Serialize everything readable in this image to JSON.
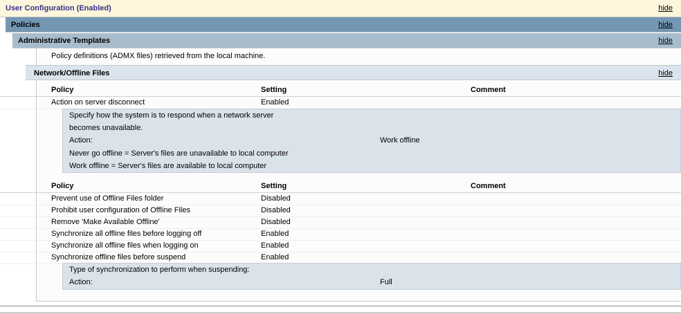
{
  "sections": {
    "user_config": {
      "title": "User Configuration (Enabled)",
      "hide": "hide"
    },
    "policies": {
      "title": "Policies",
      "hide": "hide"
    },
    "admin_templates": {
      "title": "Administrative Templates",
      "hide": "hide",
      "note": "Policy definitions (ADMX files) retrieved from the local machine."
    },
    "network_offline": {
      "title": "Network/Offline Files",
      "hide": "hide"
    }
  },
  "columns": {
    "policy": "Policy",
    "setting": "Setting",
    "comment": "Comment"
  },
  "table1": {
    "rows": [
      {
        "policy": "Action on server disconnect",
        "setting": "Enabled"
      }
    ],
    "detail": {
      "line1": "Specify how the system is to respond when a network server",
      "line2": "becomes unavailable.",
      "action_label": "Action:",
      "action_value": "Work offline",
      "line3": "Never go offline = Server's files are unavailable to local computer",
      "line4": "Work offline = Server's files are available to local computer"
    }
  },
  "table2": {
    "rows": [
      {
        "policy": "Prevent use of Offline Files folder",
        "setting": "Disabled"
      },
      {
        "policy": "Prohibit user configuration of Offline Files",
        "setting": "Disabled"
      },
      {
        "policy": "Remove 'Make Available Offline'",
        "setting": "Disabled"
      },
      {
        "policy": "Synchronize all offline files before logging off",
        "setting": "Enabled"
      },
      {
        "policy": "Synchronize all offline files when logging on",
        "setting": "Enabled"
      },
      {
        "policy": "Synchronize offline files before suspend",
        "setting": "Enabled"
      }
    ],
    "detail": {
      "line1": "Type of synchronization to perform when suspending:",
      "action_label": "Action:",
      "action_value": "Full"
    }
  }
}
